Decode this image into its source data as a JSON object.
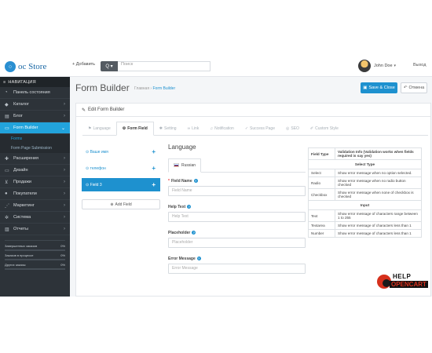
{
  "header": {
    "logo_text": "oc Store",
    "add_label": "+ Добавить",
    "search_placeholder": "Поиск",
    "user_name": "John Doe",
    "logout_label": "Выход"
  },
  "sidebar": {
    "title": "НАВИГАЦИЯ",
    "items": [
      {
        "label": "Панель состояния",
        "icon": "dashboard-icon"
      },
      {
        "label": "Каталог",
        "icon": "tag-icon"
      },
      {
        "label": "Блог",
        "icon": "book-icon"
      },
      {
        "label": "Form Builder",
        "icon": "file-icon"
      }
    ],
    "subitems": [
      {
        "label": "Forms"
      },
      {
        "label": "Form Page Submission"
      }
    ],
    "items2": [
      {
        "label": "Расширения",
        "icon": "puzzle-icon"
      },
      {
        "label": "Дизайн",
        "icon": "desktop-icon"
      },
      {
        "label": "Продажи",
        "icon": "cart-icon"
      },
      {
        "label": "Покупатели",
        "icon": "user-icon"
      },
      {
        "label": "Маркетинг",
        "icon": "share-icon"
      },
      {
        "label": "Система",
        "icon": "gear-icon"
      },
      {
        "label": "Отчеты",
        "icon": "chart-icon"
      }
    ],
    "stats": [
      {
        "label": "Завершенных заказов",
        "value": "0%"
      },
      {
        "label": "Заказов в процессе",
        "value": "0%"
      },
      {
        "label": "Других заказы",
        "value": "0%"
      }
    ]
  },
  "page": {
    "title": "Form Builder",
    "crumb_home": "Главная",
    "crumb_current": "Form Builder",
    "save_label": "Save & Close",
    "cancel_label": "Отмена",
    "panel_title": "Edit Form Builder"
  },
  "tabs": [
    {
      "label": "Language"
    },
    {
      "label": "Form Field"
    },
    {
      "label": "Setting"
    },
    {
      "label": "Link"
    },
    {
      "label": "Notification"
    },
    {
      "label": "Success Page"
    },
    {
      "label": "SEO"
    },
    {
      "label": "Custom Style"
    }
  ],
  "fields": {
    "items": [
      {
        "label": "Ваше имя"
      },
      {
        "label": "телефон"
      },
      {
        "label": "Field 3"
      }
    ],
    "add_label": "Add Field"
  },
  "editor": {
    "title": "Language",
    "lang_tab": "Russian",
    "field_name_label": "Field Name",
    "field_name_placeholder": "Field Name",
    "help_label": "Help Text",
    "help_placeholder": "Help Text",
    "placeholder_label": "Placeholder",
    "placeholder_placeholder": "Placeholder",
    "error_label": "Error Message",
    "error_placeholder": "Error Message"
  },
  "validation": {
    "col_type": "Field Type",
    "col_info": "Validation Info (Validation works when fields required is say yes)",
    "cat_select": "Select Type",
    "select_rows": [
      {
        "type": "Select",
        "info": "Show error message when no option selected."
      },
      {
        "type": "Radio",
        "info": "Show error message when no radio button checked"
      },
      {
        "type": "Checkbox",
        "info": "Show error message when none of checkbox is checked"
      }
    ],
    "cat_input": "Input",
    "input_rows": [
      {
        "type": "Text",
        "info": "Show error message of characters range between 1 to 255"
      },
      {
        "type": "Textarea",
        "info": "Show error message of characters less than 1"
      },
      {
        "type": "Number",
        "info": "Show error message of characters less than 1"
      }
    ]
  },
  "watermark": {
    "line1": "HELP",
    "line2": "OPENCART"
  },
  "colors": {
    "accent": "#1e91cf",
    "sidebar": "#2d3339",
    "active_nav": "#22a3dc"
  }
}
